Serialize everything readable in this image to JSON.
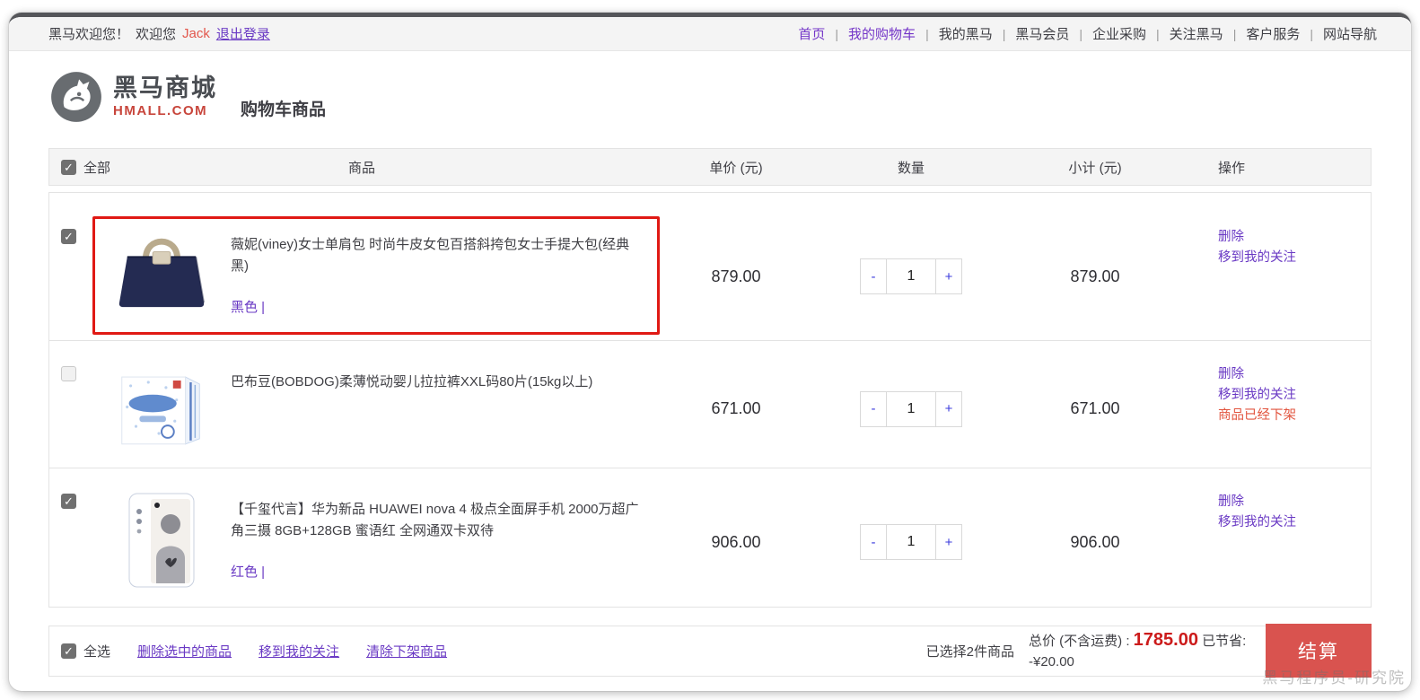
{
  "topbar": {
    "welcome_prefix": "黑马欢迎您！",
    "welcome_text": "欢迎您",
    "username": "Jack",
    "logout_label": "退出登录",
    "nav": [
      {
        "label": "首页",
        "active": true
      },
      {
        "label": "我的购物车",
        "active": true
      },
      {
        "label": "我的黑马",
        "active": false
      },
      {
        "label": "黑马会员",
        "active": false
      },
      {
        "label": "企业采购",
        "active": false
      },
      {
        "label": "关注黑马",
        "active": false
      },
      {
        "label": "客户服务",
        "active": false
      },
      {
        "label": "网站导航",
        "active": false
      }
    ]
  },
  "brand": {
    "name": "黑马商城",
    "domain": "HMALL.COM"
  },
  "page_title": "购物车商品",
  "table": {
    "select_all_label": "全部",
    "select_all_checked": true,
    "columns": {
      "product": "商品",
      "price": "单价 (元)",
      "qty": "数量",
      "subtotal": "小计 (元)",
      "actions": "操作"
    }
  },
  "stepper": {
    "minus": "-",
    "plus": "+"
  },
  "cart_items": [
    {
      "checked": true,
      "highlighted": true,
      "image": "handbag",
      "title": "薇妮(viney)女士单肩包 时尚牛皮女包百搭斜挎包女士手提大包(经典黑)",
      "variant": "黑色 |",
      "price": "879.00",
      "qty": "1",
      "subtotal": "879.00",
      "actions": [
        "删除",
        "移到我的关注"
      ],
      "notice": ""
    },
    {
      "checked": false,
      "highlighted": false,
      "image": "diapers",
      "title": "巴布豆(BOBDOG)柔薄悦动婴儿拉拉裤XXL码80片(15kg以上)",
      "variant": "",
      "price": "671.00",
      "qty": "1",
      "subtotal": "671.00",
      "actions": [
        "删除",
        "移到我的关注"
      ],
      "notice": "商品已经下架"
    },
    {
      "checked": true,
      "highlighted": false,
      "image": "phone",
      "title": "【千玺代言】华为新品 HUAWEI nova 4 极点全面屏手机 2000万超广角三摄 8GB+128GB 蜜语红 全网通双卡双待",
      "variant": "红色 |",
      "price": "906.00",
      "qty": "1",
      "subtotal": "906.00",
      "actions": [
        "删除",
        "移到我的关注"
      ],
      "notice": ""
    }
  ],
  "footer": {
    "select_all_label": "全选",
    "select_all_checked": true,
    "bulk_actions": [
      "删除选中的商品",
      "移到我的关注",
      "清除下架商品"
    ],
    "selected_text": "已选择2件商品",
    "total_label": "总价 (不含运费) : ",
    "total_value": "1785.00",
    "savings_text": "已节省: -¥20.00",
    "checkout_label": "结算"
  },
  "watermark": "黑马程序员-研究院",
  "colors": {
    "accent_red": "#d9534f",
    "price_red": "#cc1b1b",
    "link_purple": "#6a3ac4",
    "notice_orange": "#e2553f",
    "highlight_border": "#e01914",
    "topbar_bg": "#f4f4f4"
  }
}
